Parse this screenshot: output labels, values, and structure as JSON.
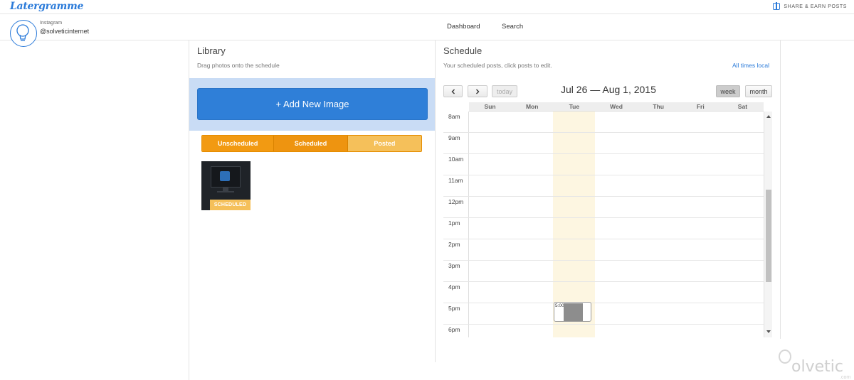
{
  "app": {
    "logo": "Latergramme",
    "share_link": "SHARE & EARN POSTS"
  },
  "account": {
    "label": "Instagram",
    "handle": "@solveticinternet"
  },
  "nav": [
    {
      "label": "Dashboard"
    },
    {
      "label": "Search"
    }
  ],
  "library": {
    "title": "Library",
    "subtitle": "Drag photos onto the schedule",
    "add_button": "+ Add New Image",
    "filters": [
      "Unscheduled",
      "Scheduled",
      "Posted"
    ],
    "thumbnail_badge": "SCHEDULED"
  },
  "schedule": {
    "title": "Schedule",
    "subtitle": "Your scheduled posts, click posts to edit.",
    "timezone_link": "All times local",
    "prev_icon": "chevron-left-icon",
    "next_icon": "chevron-right-icon",
    "today_button": "today",
    "date_range": "Jul 26 — Aug 1, 2015",
    "view_week": "week",
    "view_month": "month",
    "days": [
      "Sun",
      "Mon",
      "Tue",
      "Wed",
      "Thu",
      "Fri",
      "Sat"
    ],
    "hours": [
      "8am",
      "9am",
      "10am",
      "11am",
      "12pm",
      "1pm",
      "2pm",
      "3pm",
      "4pm",
      "5pm",
      "6pm"
    ],
    "event": {
      "time": "5:00"
    },
    "highlight_color": "#fdf6e1"
  },
  "watermark": {
    "text": "olvetic",
    "suffix": ".com"
  },
  "colors": {
    "accent": "#2a7ad9",
    "orange": "#f29a12",
    "orange_light": "#f5c05a"
  }
}
